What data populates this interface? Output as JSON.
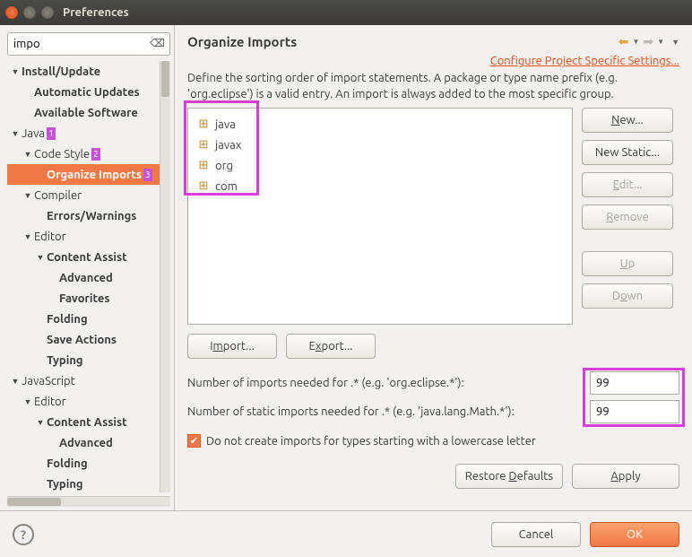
{
  "window": {
    "title": "Preferences"
  },
  "search": {
    "value": "impo"
  },
  "tree": [
    {
      "id": "install-update",
      "label": "Install/Update",
      "depth": 0,
      "expanded": true,
      "bold": true,
      "children": [
        {
          "id": "automatic-updates",
          "label": "Automatic Updates",
          "depth": 1,
          "bold": true
        },
        {
          "id": "available-software",
          "label": "Available Software",
          "depth": 1,
          "bold": true
        }
      ]
    },
    {
      "id": "java",
      "label": "Java",
      "depth": 0,
      "expanded": true,
      "badge": "1",
      "children": [
        {
          "id": "code-style",
          "label": "Code Style",
          "depth": 1,
          "expanded": true,
          "badge": "2",
          "children": [
            {
              "id": "organize-imports",
              "label": "Organize Imports",
              "depth": 2,
              "selected": true,
              "bold": true,
              "badge": "3"
            }
          ]
        },
        {
          "id": "compiler",
          "label": "Compiler",
          "depth": 1,
          "expanded": true,
          "children": [
            {
              "id": "errors-warnings",
              "label": "Errors/Warnings",
              "depth": 2,
              "bold": true
            }
          ]
        },
        {
          "id": "java-editor",
          "label": "Editor",
          "depth": 1,
          "expanded": true,
          "children": [
            {
              "id": "content-assist",
              "label": "Content Assist",
              "depth": 2,
              "expanded": true,
              "bold": true,
              "children": [
                {
                  "id": "advanced",
                  "label": "Advanced",
                  "depth": 3,
                  "bold": true
                },
                {
                  "id": "favorites",
                  "label": "Favorites",
                  "depth": 3,
                  "bold": true
                }
              ]
            },
            {
              "id": "folding",
              "label": "Folding",
              "depth": 2,
              "bold": true
            },
            {
              "id": "save-actions",
              "label": "Save Actions",
              "depth": 2,
              "bold": true
            },
            {
              "id": "typing",
              "label": "Typing",
              "depth": 2,
              "bold": true
            }
          ]
        }
      ]
    },
    {
      "id": "javascript",
      "label": "JavaScript",
      "depth": 0,
      "expanded": true,
      "children": [
        {
          "id": "js-editor",
          "label": "Editor",
          "depth": 1,
          "expanded": true,
          "children": [
            {
              "id": "js-content-assist",
              "label": "Content Assist",
              "depth": 2,
              "expanded": true,
              "bold": true,
              "children": [
                {
                  "id": "js-advanced",
                  "label": "Advanced",
                  "depth": 3,
                  "bold": true
                }
              ]
            },
            {
              "id": "js-folding",
              "label": "Folding",
              "depth": 2,
              "bold": true
            },
            {
              "id": "js-typing",
              "label": "Typing",
              "depth": 2,
              "bold": true
            }
          ]
        }
      ]
    }
  ],
  "page": {
    "title": "Organize Imports",
    "configLink": "Configure Project Specific Settings...",
    "description": "Define the sorting order of import statements. A package or type name prefix (e.g. 'org.eclipse') is a valid entry. An import is always added to the most specific group.",
    "sortList": [
      "java",
      "javax",
      "org",
      "com"
    ],
    "buttons": {
      "new": "New...",
      "newStatic": "New Static...",
      "edit": "Edit...",
      "remove": "Remove",
      "up": "Up",
      "down": "Down",
      "import": "Import...",
      "export": "Export...",
      "restore": "Restore Defaults",
      "apply": "Apply"
    },
    "importsLabel": "Number of imports needed for .* (e.g. 'org.eclipse.*'):",
    "importsValue": "99",
    "staticLabel": "Number of static imports needed for .* (e.g. 'java.lang.Math.*'):",
    "staticValue": "99",
    "checkboxLabel": "Do not create imports for types starting with a lowercase letter",
    "checkboxChecked": true
  },
  "dialog": {
    "cancel": "Cancel",
    "ok": "OK"
  }
}
